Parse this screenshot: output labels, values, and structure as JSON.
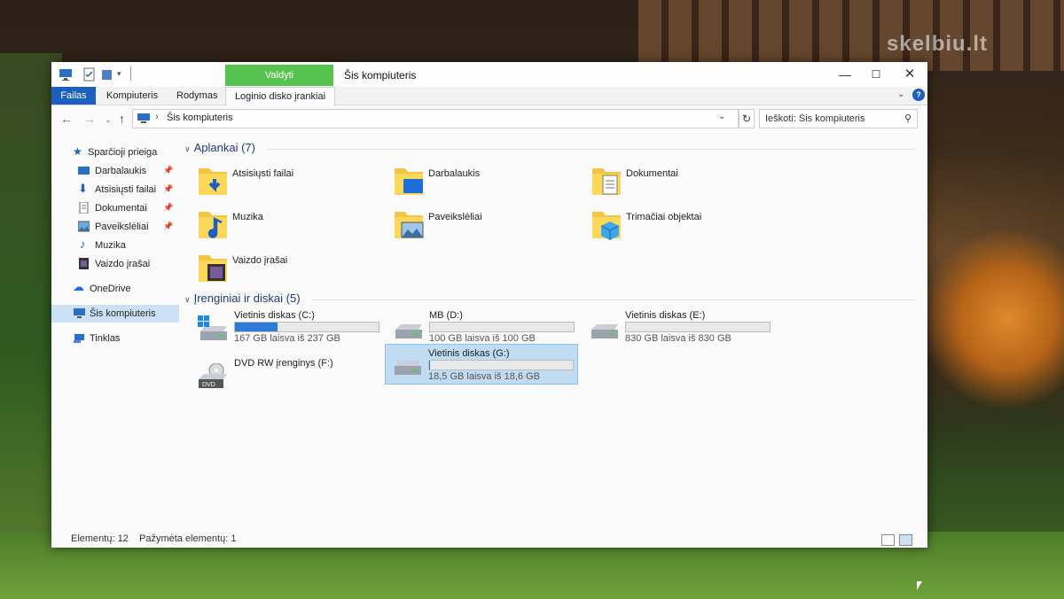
{
  "watermark": "skelbiu.lt",
  "titlebar": {
    "context_tab": "Valdyti",
    "title": "Šis kompiuteris",
    "controls": {
      "minimize": "—",
      "maximize": "☐",
      "close": "✕"
    }
  },
  "ribbon": {
    "tabs": [
      "Failas",
      "Kompiuteris",
      "Rodymas",
      "Loginio disko įrankiai"
    ],
    "help": "?"
  },
  "address": {
    "path": "Šis kompiuteris",
    "search_placeholder": "Ieškoti: Šis kompiuteris"
  },
  "navpane": {
    "quick_access": "Sparčioji prieiga",
    "pinned": [
      "Darbalaukis",
      "Atsisiųsti failai",
      "Dokumentai",
      "Paveikslėliai"
    ],
    "unpinned": [
      "Muzika",
      "Vaizdo įrašai"
    ],
    "onedrive": "OneDrive",
    "this_pc": "Šis kompiuteris",
    "network": "Tinklas"
  },
  "folders_header": "Aplankai (7)",
  "folders": [
    {
      "name": "Atsisiųsti failai",
      "icon": "downloads-icon"
    },
    {
      "name": "Darbalaukis",
      "icon": "desktop-icon"
    },
    {
      "name": "Dokumentai",
      "icon": "documents-icon"
    },
    {
      "name": "Muzika",
      "icon": "music-icon"
    },
    {
      "name": "Paveikslėliai",
      "icon": "pictures-icon"
    },
    {
      "name": "Trimačiai objektai",
      "icon": "3d-objects-icon"
    },
    {
      "name": "Vaizdo įrašai",
      "icon": "videos-icon"
    }
  ],
  "devices_header": "Įrenginiai ir diskai (5)",
  "drives": [
    {
      "name": "Vietinis diskas (C:)",
      "free": "167 GB laisva iš 237 GB",
      "used_fraction": 0.295,
      "icon": "windows-drive-icon",
      "selected": false
    },
    {
      "name": "MB (D:)",
      "free": "100 GB laisva iš 100 GB",
      "used_fraction": 0.0,
      "icon": "hard-drive-icon",
      "selected": false
    },
    {
      "name": "Vietinis diskas (E:)",
      "free": "830 GB laisva iš 830 GB",
      "used_fraction": 0.0,
      "icon": "hard-drive-icon",
      "selected": false
    },
    {
      "name": "DVD RW įrenginys (F:)",
      "free": "",
      "used_fraction": null,
      "icon": "dvd-drive-icon",
      "selected": false
    },
    {
      "name": "Vietinis diskas (G:)",
      "free": "18,5 GB laisva iš 18,6 GB",
      "used_fraction": 0.005,
      "icon": "hard-drive-icon",
      "selected": true
    }
  ],
  "status": {
    "count": "Elementų: 12",
    "selected": "Pažymėta elementų: 1"
  },
  "colors": {
    "accent": "#1c5fbf",
    "context_tab": "#56c34e",
    "progress": "#2b7ad6",
    "selection": "#bfdcf3"
  }
}
